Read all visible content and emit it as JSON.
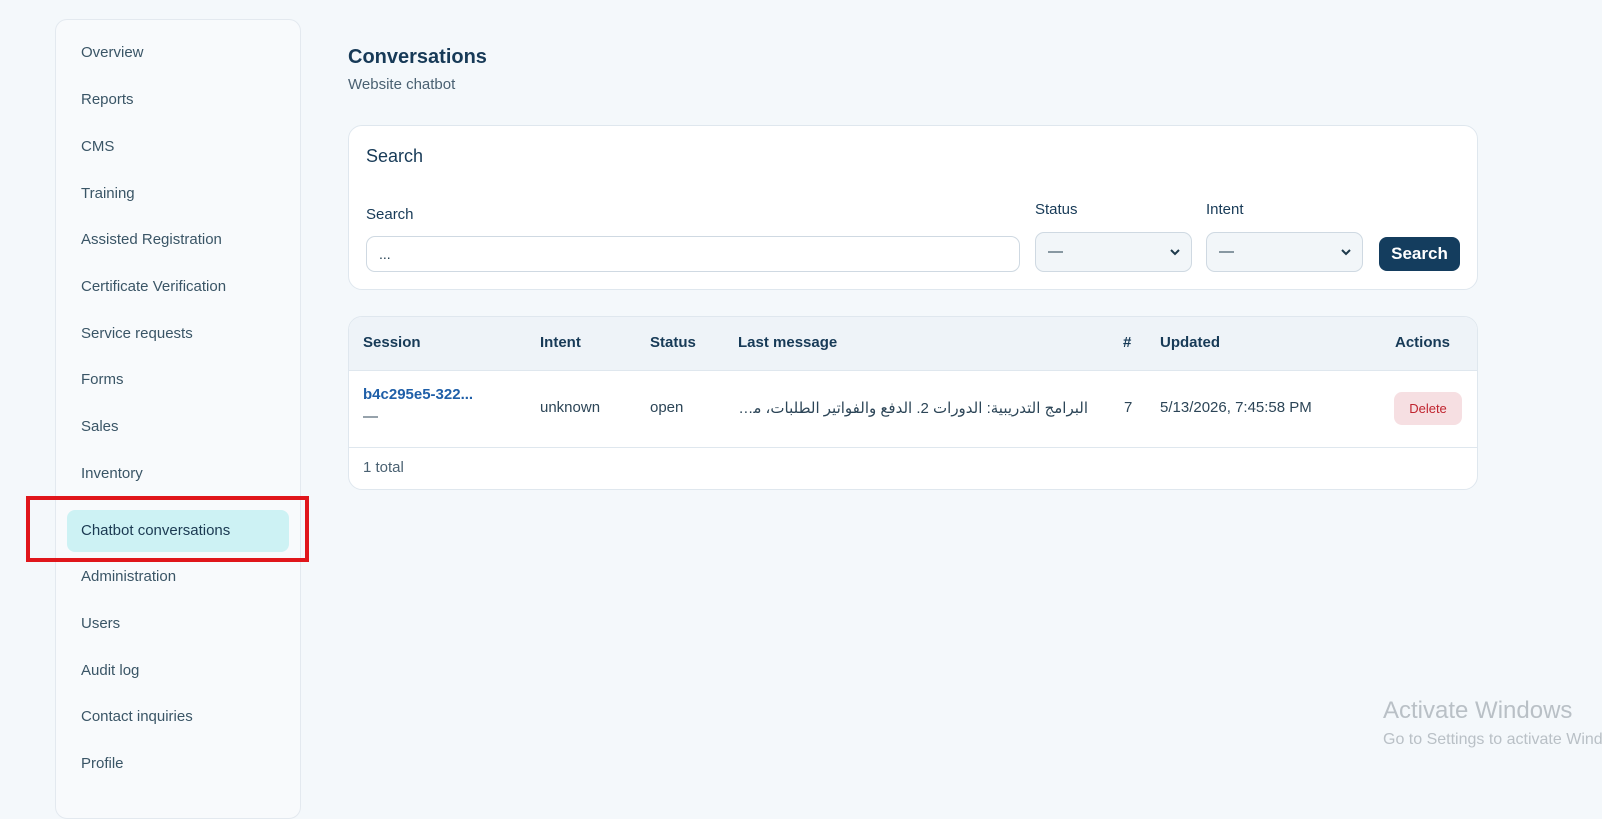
{
  "sidebar": {
    "items": [
      {
        "label": "Overview"
      },
      {
        "label": "Reports"
      },
      {
        "label": "CMS"
      },
      {
        "label": "Training"
      },
      {
        "label": "Assisted Registration"
      },
      {
        "label": "Certificate Verification"
      },
      {
        "label": "Service requests"
      },
      {
        "label": "Forms"
      },
      {
        "label": "Sales"
      },
      {
        "label": "Inventory"
      },
      {
        "label": "Chatbot conversations",
        "active": true
      },
      {
        "label": "Administration"
      },
      {
        "label": "Users"
      },
      {
        "label": "Audit log"
      },
      {
        "label": "Contact inquiries"
      },
      {
        "label": "Profile"
      }
    ]
  },
  "header": {
    "title": "Conversations",
    "subtitle": "Website chatbot"
  },
  "search": {
    "card_title": "Search",
    "search_label": "Search",
    "search_value": "...",
    "status_label": "Status",
    "status_value": "—",
    "intent_label": "Intent",
    "intent_value": "—",
    "button_label": "Search"
  },
  "table": {
    "columns": [
      "Session",
      "Intent",
      "Status",
      "Last message",
      "#",
      "Updated",
      "Actions"
    ],
    "rows": [
      {
        "session": "b4c295e5-322...",
        "session_sub": "—",
        "intent": "unknown",
        "status": "open",
        "last_message": "البرامج التدريبية: الدورات 2. الدفع والفواتير الطلبات، متوفر...",
        "count": "7",
        "updated": "5/13/2026, 7:45:58 PM",
        "action": "Delete"
      }
    ],
    "total": "1 total"
  },
  "watermark": {
    "title": "Activate Windows",
    "subtitle": "Go to Settings to activate Windows."
  },
  "colors": {
    "accent": "#143d5e",
    "active_nav": "#cdf2f4",
    "delete": "#c0242f",
    "highlight": "#e0161b"
  }
}
